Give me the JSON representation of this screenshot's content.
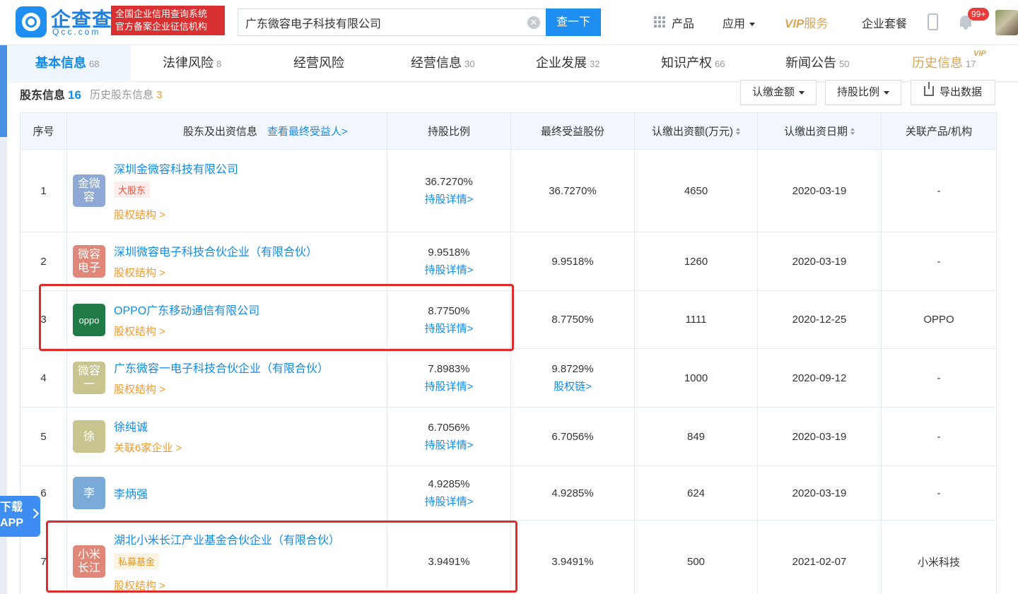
{
  "header": {
    "logo_name": "企查查",
    "logo_domain": "Qcc.com",
    "badge_line1": "全国企业信用查询系统",
    "badge_line2": "官方备案企业征信机构",
    "search_value": "广东微容电子科技有限公司",
    "search_button": "查一下",
    "nav_products": "产品",
    "nav_apps": "应用",
    "nav_vip_a": "VIP",
    "nav_vip_b": "服务",
    "nav_package": "企业套餐",
    "notif_count": "99+"
  },
  "tabs": [
    {
      "label": "基本信息",
      "count": "68"
    },
    {
      "label": "法律风险",
      "count": "8"
    },
    {
      "label": "经营风险",
      "count": ""
    },
    {
      "label": "经营信息",
      "count": "30"
    },
    {
      "label": "企业发展",
      "count": "32"
    },
    {
      "label": "知识产权",
      "count": "66"
    },
    {
      "label": "新闻公告",
      "count": "50"
    },
    {
      "label": "历史信息",
      "count": "17"
    }
  ],
  "vip_tag": "VIP",
  "section": {
    "title": "股东信息",
    "count": "16",
    "history_label": "历史股东信息",
    "history_count": "3",
    "btn_amount": "认缴金额",
    "btn_ratio": "持股比例",
    "btn_export": "导出数据"
  },
  "table": {
    "headers": {
      "seq": "序号",
      "holder": "股东及出资信息",
      "holder_link": "查看最终受益人>",
      "ratio": "持股比例",
      "ultimate": "最终受益股份",
      "amount": "认缴出资额(万元)",
      "date": "认缴出资日期",
      "related": "关联产品/机构"
    },
    "rows": [
      {
        "seq": "1",
        "logo": "金微容",
        "name": "深圳金微容科技有限公司",
        "tag": "大股东",
        "sub": "股权结构 >",
        "ratio": "36.7270%",
        "ratio_link": "持股详情>",
        "ultimate": "36.7270%",
        "ultimate_link": "",
        "amount": "4650",
        "date": "2020-03-19",
        "related": "-"
      },
      {
        "seq": "2",
        "logo": "微容电子",
        "name": "深圳微容电子科技合伙企业（有限合伙）",
        "tag": "",
        "sub": "股权结构 >",
        "ratio": "9.9518%",
        "ratio_link": "持股详情>",
        "ultimate": "9.9518%",
        "ultimate_link": "",
        "amount": "1260",
        "date": "2020-03-19",
        "related": "-"
      },
      {
        "seq": "3",
        "logo": "oppo",
        "name": "OPPO广东移动通信有限公司",
        "tag": "",
        "sub": "股权结构 >",
        "ratio": "8.7750%",
        "ratio_link": "持股详情>",
        "ultimate": "8.7750%",
        "ultimate_link": "",
        "amount": "1111",
        "date": "2020-12-25",
        "related": "OPPO"
      },
      {
        "seq": "4",
        "logo": "微容一",
        "name": "广东微容一电子科技合伙企业（有限合伙）",
        "tag": "",
        "sub": "股权结构 >",
        "ratio": "7.8983%",
        "ratio_link": "持股详情>",
        "ultimate": "9.8729%",
        "ultimate_link": "股权链>",
        "amount": "1000",
        "date": "2020-09-12",
        "related": "-"
      },
      {
        "seq": "5",
        "logo": "徐",
        "name": "徐纯诚",
        "tag": "",
        "sub": "关联6家企业 >",
        "ratio": "6.7056%",
        "ratio_link": "持股详情>",
        "ultimate": "6.7056%",
        "ultimate_link": "",
        "amount": "849",
        "date": "2020-03-19",
        "related": "-"
      },
      {
        "seq": "6",
        "logo": "李",
        "name": "李炳强",
        "tag": "",
        "sub": "",
        "ratio": "4.9285%",
        "ratio_link": "持股详情>",
        "ultimate": "4.9285%",
        "ultimate_link": "",
        "amount": "624",
        "date": "2020-03-19",
        "related": "-"
      },
      {
        "seq": "7",
        "logo": "小米长江",
        "name": "湖北小米长江产业基金合伙企业（有限合伙）",
        "tag": "私募基金",
        "sub": "股权结构 >",
        "ratio": "3.9491%",
        "ratio_link": "",
        "ultimate": "3.9491%",
        "ultimate_link": "",
        "amount": "500",
        "date": "2021-02-07",
        "related": "小米科技"
      }
    ]
  },
  "app_float": {
    "line1": "下载",
    "line2": "APP"
  },
  "colors": {
    "brand_blue": "#128bed",
    "highlight_red": "#e02b2b",
    "vip_gold": "#d7a657"
  }
}
